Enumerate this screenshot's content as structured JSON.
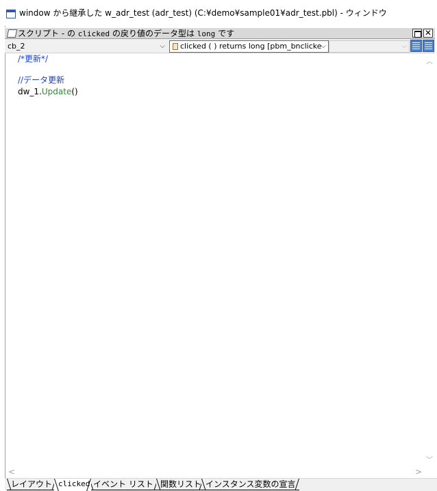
{
  "window": {
    "title": "window から継承した w_adr_test (adr_test) (C:¥demo¥sample01¥adr_test.pbl) - ウィンドウ"
  },
  "script_header": {
    "prefix": "スクリプト -  の ",
    "event_mono": "clicked",
    "middle": " の戻り値のデータ型は ",
    "type_mono": "long",
    "suffix": " です",
    "close_glyph": "✕"
  },
  "toolbar": {
    "object_value": "cb_2",
    "event_value": "clicked ( )  returns long [pbm_bnclicke",
    "ancestor_value": "",
    "chevron": "⌵"
  },
  "editor": {
    "lines": [
      {
        "text": "/*更新*/",
        "kind": "comment"
      },
      {
        "text": "",
        "kind": "blank"
      },
      {
        "text": "//データ更新",
        "kind": "comment"
      },
      {
        "obj": "dw_1.",
        "fn": "Update",
        "args": "()",
        "kind": "code"
      }
    ]
  },
  "scrollbars": {
    "up": "︿",
    "down": "﹀",
    "left": "<",
    "right": ">"
  },
  "tabs": [
    {
      "label": "レイアウト",
      "active": false
    },
    {
      "label": "clicked",
      "active": true
    },
    {
      "label": "イベント リスト",
      "active": false
    },
    {
      "label": "関数リスト",
      "active": false
    },
    {
      "label": "インスタンス変数の宣言",
      "active": false
    }
  ],
  "colors": {
    "comment": "#1a3fd6",
    "function": "#2e8b2e",
    "header_bg": "#d9d9d9",
    "toolbar_button": "#4a7fd0"
  }
}
